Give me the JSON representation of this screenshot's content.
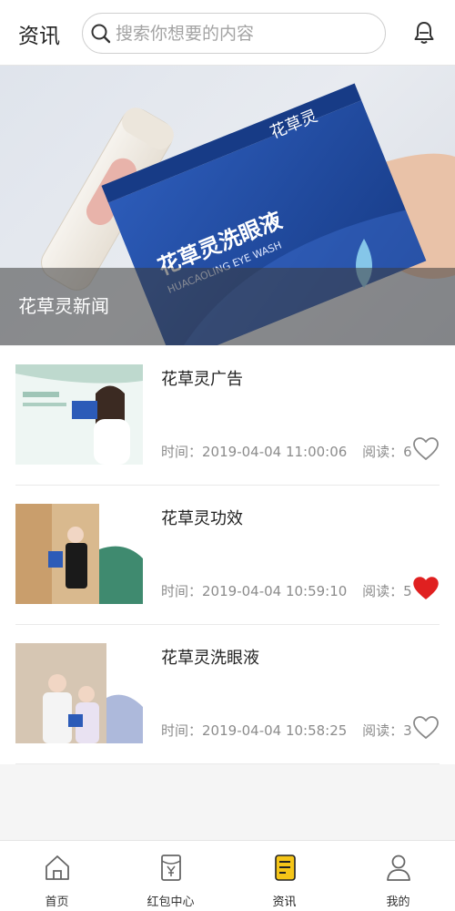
{
  "header": {
    "title": "资讯",
    "search_placeholder": "搜索你想要的内容"
  },
  "banner": {
    "caption": "花草灵新闻",
    "product_text": "花草灵洗眼液",
    "product_subtext": "HUACAOLING EYE WASH",
    "brand_logo_text": "花草灵"
  },
  "news": [
    {
      "title": "花草灵广告",
      "time_label": "时间：",
      "time": "2019-04-04 11:00:06",
      "reads_label": "阅读：",
      "reads": "6",
      "liked": false
    },
    {
      "title": "花草灵功效",
      "time_label": "时间：",
      "time": "2019-04-04 10:59:10",
      "reads_label": "阅读：",
      "reads": "5",
      "liked": true
    },
    {
      "title": "花草灵洗眼液",
      "time_label": "时间：",
      "time": "2019-04-04 10:58:25",
      "reads_label": "阅读：",
      "reads": "3",
      "liked": false
    }
  ],
  "tabs": [
    {
      "label": "首页",
      "icon": "home-icon"
    },
    {
      "label": "红包中心",
      "icon": "red-envelope-icon"
    },
    {
      "label": "资讯",
      "icon": "news-icon",
      "active": true
    },
    {
      "label": "我的",
      "icon": "user-icon"
    }
  ],
  "colors": {
    "accent": "#f5c518",
    "like": "#e02020",
    "product_blue": "#1f4aa0"
  }
}
